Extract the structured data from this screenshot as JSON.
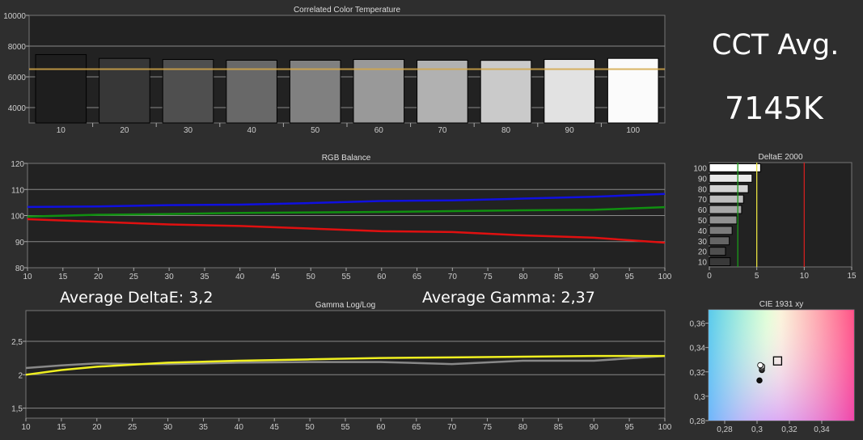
{
  "summary": {
    "cct_avg_label": "CCT Avg.",
    "cct_avg_value": "7145K",
    "avg_deltae_label": "Average DeltaE: 3,2",
    "avg_gamma_label": "Average Gamma: 2,37"
  },
  "chart_data": [
    {
      "id": "cct",
      "type": "bar",
      "title": "Correlated Color Temperature",
      "categories": [
        "10",
        "20",
        "30",
        "40",
        "50",
        "60",
        "70",
        "80",
        "90",
        "100"
      ],
      "values": [
        7450,
        7200,
        7130,
        7080,
        7080,
        7130,
        7080,
        7070,
        7130,
        7200
      ],
      "target": 6500,
      "target_color": "#d4a84a",
      "ylim": [
        3000,
        10000
      ],
      "yticks": [
        4000,
        6000,
        8000,
        10000
      ],
      "grid": true
    },
    {
      "id": "rgb",
      "type": "line",
      "title": "RGB Balance",
      "x": [
        10,
        20,
        30,
        40,
        50,
        60,
        70,
        80,
        90,
        100
      ],
      "xticks": [
        10,
        15,
        20,
        25,
        30,
        35,
        40,
        45,
        50,
        55,
        60,
        65,
        70,
        75,
        80,
        85,
        90,
        95,
        100
      ],
      "ylim": [
        80,
        120
      ],
      "yticks": [
        80,
        90,
        100,
        110,
        120
      ],
      "grid": true,
      "series": [
        {
          "color": "#1010e0",
          "values": [
            103.3,
            103.5,
            104,
            104.2,
            104.8,
            105.6,
            105.8,
            106.5,
            107.2,
            108.3
          ]
        },
        {
          "color": "#109010",
          "values": [
            99.6,
            100.3,
            100.6,
            101,
            101.2,
            101.4,
            101.7,
            102,
            102.2,
            103.2
          ]
        },
        {
          "color": "#e01010",
          "values": [
            98.6,
            97.6,
            96.6,
            96,
            95,
            94,
            93.7,
            92.4,
            91.5,
            89.6
          ]
        }
      ]
    },
    {
      "id": "gamma",
      "type": "line",
      "title": "Gamma Log/Log",
      "x": [
        10,
        15,
        20,
        25,
        30,
        40,
        50,
        60,
        70,
        80,
        90,
        100
      ],
      "xticks": [
        10,
        15,
        20,
        25,
        30,
        35,
        40,
        45,
        50,
        55,
        60,
        65,
        70,
        75,
        80,
        85,
        90,
        95,
        100
      ],
      "ylim": [
        1.35,
        2.96
      ],
      "yticks": [
        1.5,
        2,
        2.5
      ],
      "ytick_labels": [
        "1,5",
        "2",
        "2,5"
      ],
      "grid": true,
      "series": [
        {
          "color": "#888888",
          "values": [
            2.1,
            2.14,
            2.17,
            2.16,
            2.16,
            2.18,
            2.19,
            2.19,
            2.16,
            2.21,
            2.21,
            2.28
          ]
        },
        {
          "color": "#f0f020",
          "values": [
            2.0,
            2.07,
            2.12,
            2.15,
            2.18,
            2.21,
            2.23,
            2.25,
            2.26,
            2.27,
            2.28,
            2.28
          ]
        }
      ]
    },
    {
      "id": "deltae",
      "type": "bar",
      "orientation": "horizontal",
      "title": "DeltaE 2000",
      "categories": [
        "100",
        "90",
        "80",
        "70",
        "60",
        "50",
        "40",
        "30",
        "20",
        "10"
      ],
      "values": [
        5.4,
        4.5,
        4.1,
        3.6,
        3.4,
        2.9,
        2.4,
        2.1,
        1.7,
        2.2
      ],
      "xlim": [
        0,
        15
      ],
      "xticks": [
        0,
        5,
        10,
        15
      ],
      "thresholds": [
        {
          "value": 3,
          "color": "#1a9a1a"
        },
        {
          "value": 5,
          "color": "#e8e040"
        },
        {
          "value": 10,
          "color": "#d02020"
        }
      ]
    },
    {
      "id": "cie",
      "type": "scatter",
      "title": "CIE 1931 xy",
      "xlim": [
        0.27,
        0.36
      ],
      "ylim": [
        0.28,
        0.371
      ],
      "xticks": [
        0.28,
        0.3,
        0.32,
        0.34
      ],
      "xtick_labels": [
        "0,28",
        "0,3",
        "0,32",
        "0,34"
      ],
      "yticks": [
        0.28,
        0.3,
        0.32,
        0.34,
        0.36
      ],
      "ytick_labels": [
        "0,28",
        "0,3",
        "0,32",
        "0,34",
        "0,36"
      ],
      "target": {
        "x": 0.3127,
        "y": 0.329
      },
      "points": [
        {
          "x": 0.3015,
          "y": 0.313,
          "color": "#111111"
        },
        {
          "x": 0.303,
          "y": 0.3215,
          "color": "#333333"
        },
        {
          "x": 0.303,
          "y": 0.323,
          "color": "#666666"
        },
        {
          "x": 0.3032,
          "y": 0.3245,
          "color": "#aaaaaa"
        },
        {
          "x": 0.302,
          "y": 0.3255,
          "color": "#ffffff"
        }
      ]
    }
  ]
}
